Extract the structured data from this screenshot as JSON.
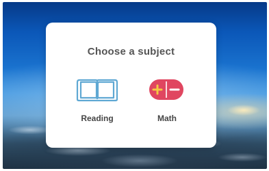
{
  "dialog": {
    "title": "Choose a subject"
  },
  "subjects": [
    {
      "label": "Reading",
      "icon": "book-icon",
      "color": "#5fa8d3"
    },
    {
      "label": "Math",
      "icon": "plus-minus-icon",
      "color": "#e04660",
      "accent": "#f0b429"
    }
  ]
}
